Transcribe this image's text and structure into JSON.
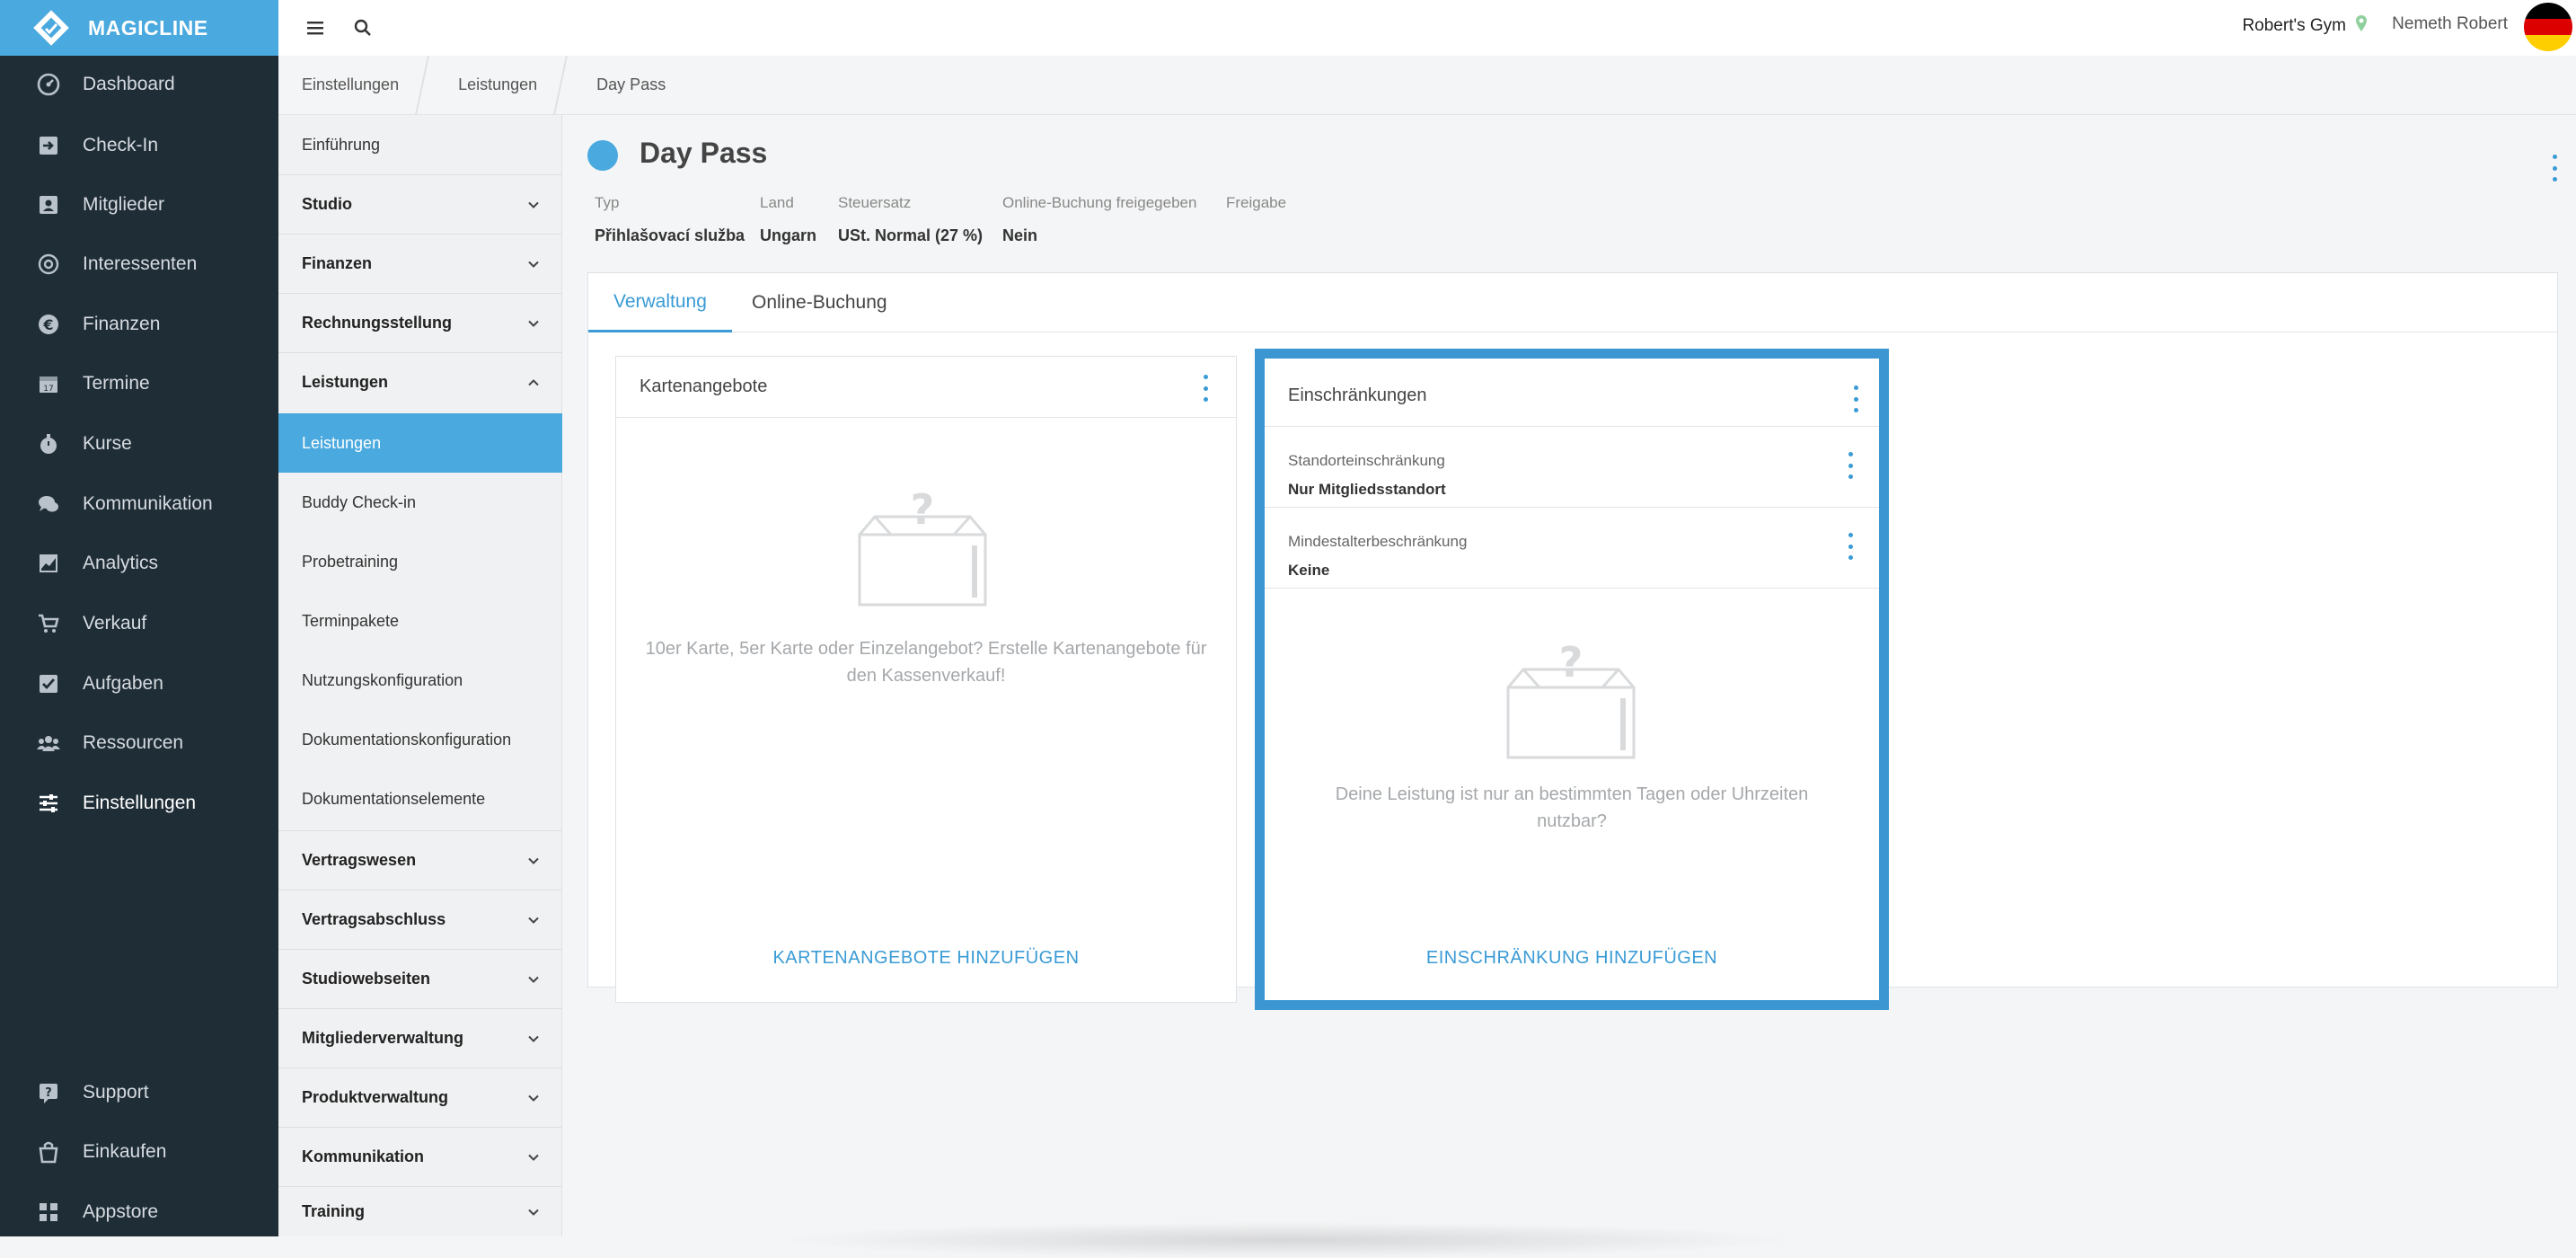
{
  "brand": {
    "name": "MAGICLINE",
    "color": "#4aa9de"
  },
  "nav": {
    "items": [
      {
        "label": "Dashboard",
        "icon": "dashboard-icon"
      },
      {
        "label": "Check-In",
        "icon": "check-in-icon"
      },
      {
        "label": "Mitglieder",
        "icon": "members-icon"
      },
      {
        "label": "Interessenten",
        "icon": "leads-icon"
      },
      {
        "label": "Finanzen",
        "icon": "euro-icon"
      },
      {
        "label": "Termine",
        "icon": "calendar-icon"
      },
      {
        "label": "Kurse",
        "icon": "stopwatch-icon"
      },
      {
        "label": "Kommunikation",
        "icon": "chat-icon"
      },
      {
        "label": "Analytics",
        "icon": "chart-icon"
      },
      {
        "label": "Verkauf",
        "icon": "cart-icon"
      },
      {
        "label": "Aufgaben",
        "icon": "checkbox-icon"
      },
      {
        "label": "Ressourcen",
        "icon": "group-icon"
      },
      {
        "label": "Einstellungen",
        "icon": "sliders-icon"
      }
    ],
    "bottom": [
      {
        "label": "Support",
        "icon": "support-icon"
      },
      {
        "label": "Einkaufen",
        "icon": "shop-icon"
      },
      {
        "label": "Appstore",
        "icon": "apps-icon"
      }
    ]
  },
  "topbar": {
    "gym": "Robert's Gym",
    "user": "Nemeth Robert"
  },
  "breadcrumb": [
    "Einstellungen",
    "Leistungen",
    "Day Pass"
  ],
  "subnav": {
    "intro": "Einführung",
    "sections_top": [
      "Studio",
      "Finanzen",
      "Rechnungsstellung"
    ],
    "open_section": "Leistungen",
    "children": [
      "Leistungen",
      "Buddy Check-in",
      "Probetraining",
      "Terminpakete",
      "Nutzungskonfiguration",
      "Dokumentationskonfiguration",
      "Dokumentationselemente"
    ],
    "sections_bottom": [
      "Vertragswesen",
      "Vertragsabschluss",
      "Studiowebseiten",
      "Mitgliederverwaltung",
      "Produktverwaltung",
      "Kommunikation",
      "Training"
    ]
  },
  "service": {
    "title": "Day Pass",
    "meta": [
      {
        "key": "Typ",
        "value": "Přihlašovací služba"
      },
      {
        "key": "Land",
        "value": "Ungarn"
      },
      {
        "key": "Steuersatz",
        "value": "USt. Normal (27 %)"
      },
      {
        "key": "Online-Buchung freigegeben",
        "value": "Nein"
      },
      {
        "key": "Freigabe",
        "value": ""
      }
    ]
  },
  "tabs": [
    "Verwaltung",
    "Online-Buchung"
  ],
  "cards": {
    "karten": {
      "title": "Kartenangebote",
      "empty": "10er Karte, 5er Karte oder Einzelangebot? Erstelle Kartenangebote für den Kassenverkauf!",
      "action": "KARTENANGEBOTE HINZUFÜGEN"
    },
    "einschr": {
      "title": "Einschränkungen",
      "rows": [
        {
          "key": "Standorteinschränkung",
          "value": "Nur Mitgliedsstandort"
        },
        {
          "key": "Mindestalterbeschränkung",
          "value": "Keine"
        }
      ],
      "empty": "Deine Leistung ist nur an bestimmten Tagen oder Uhrzeiten nutzbar?",
      "action": "EINSCHRÄNKUNG HINZUFÜGEN"
    }
  }
}
